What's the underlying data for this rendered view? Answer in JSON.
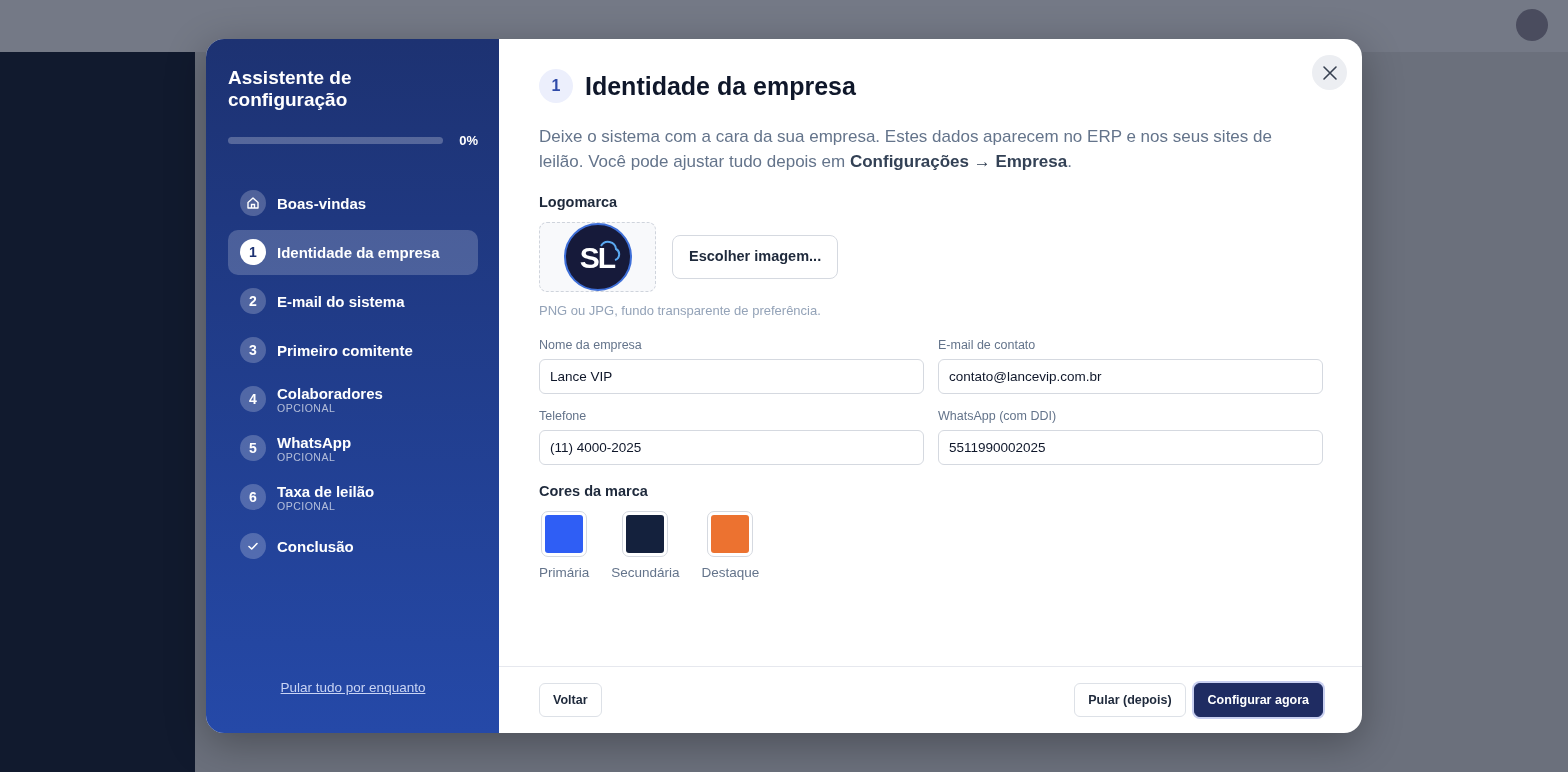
{
  "wizard": {
    "title": "Assistente de configuração",
    "progress": {
      "level": 0,
      "reading": "0%"
    },
    "steps": [
      {
        "kind": "home",
        "label": "Boas-vindas",
        "selected": false
      },
      {
        "kind": "number",
        "number": "1",
        "label": "Identidade da empresa",
        "selected": true
      },
      {
        "kind": "number",
        "number": "2",
        "label": "E-mail do sistema",
        "selected": false
      },
      {
        "kind": "number",
        "number": "3",
        "label": "Primeiro comitente",
        "selected": false
      },
      {
        "kind": "number",
        "number": "4",
        "label": "Colaboradores",
        "note": "OPCIONAL",
        "selected": false
      },
      {
        "kind": "number",
        "number": "5",
        "label": "WhatsApp",
        "note": "OPCIONAL",
        "selected": false
      },
      {
        "kind": "number",
        "number": "6",
        "label": "Taxa de leilão",
        "note": "OPCIONAL",
        "selected": false
      },
      {
        "kind": "check",
        "label": "Conclusão",
        "selected": false
      }
    ],
    "skip_all_link": "Pular tudo por enquanto"
  },
  "page": {
    "step_number": "1",
    "title": "Identidade da empresa",
    "description": "Deixe o sistema com a cara da sua empresa. Estes dados aparecem no ERP e nos seus sites de leilão. Você pode ajustar tudo depois em **Configurações → Empresa**.",
    "logo": {
      "label": "Logomarca",
      "logo_text": "SL",
      "button": "Escolher imagem...",
      "hint": "PNG ou JPG, fundo transparente de preferência."
    },
    "fields": [
      {
        "label": "Nome da empresa",
        "value": "Lance VIP"
      },
      {
        "label": "E-mail de contato",
        "value": "contato@lancevip.com.br"
      },
      {
        "label": "Telefone",
        "value": "(11) 4000-2025"
      },
      {
        "label": "WhatsApp (com DDI)",
        "value": "5511990002025"
      }
    ],
    "colors_label": "Cores da marca",
    "colors": [
      {
        "label": "Primária",
        "color": "#2f5ef5"
      },
      {
        "label": "Secundária",
        "color": "#14213d"
      },
      {
        "label": "Destaque",
        "color": "#ec7230"
      }
    ]
  },
  "footer": {
    "back": "Voltar",
    "skip": "Pular (depois)",
    "primary": "Configurar agora"
  }
}
